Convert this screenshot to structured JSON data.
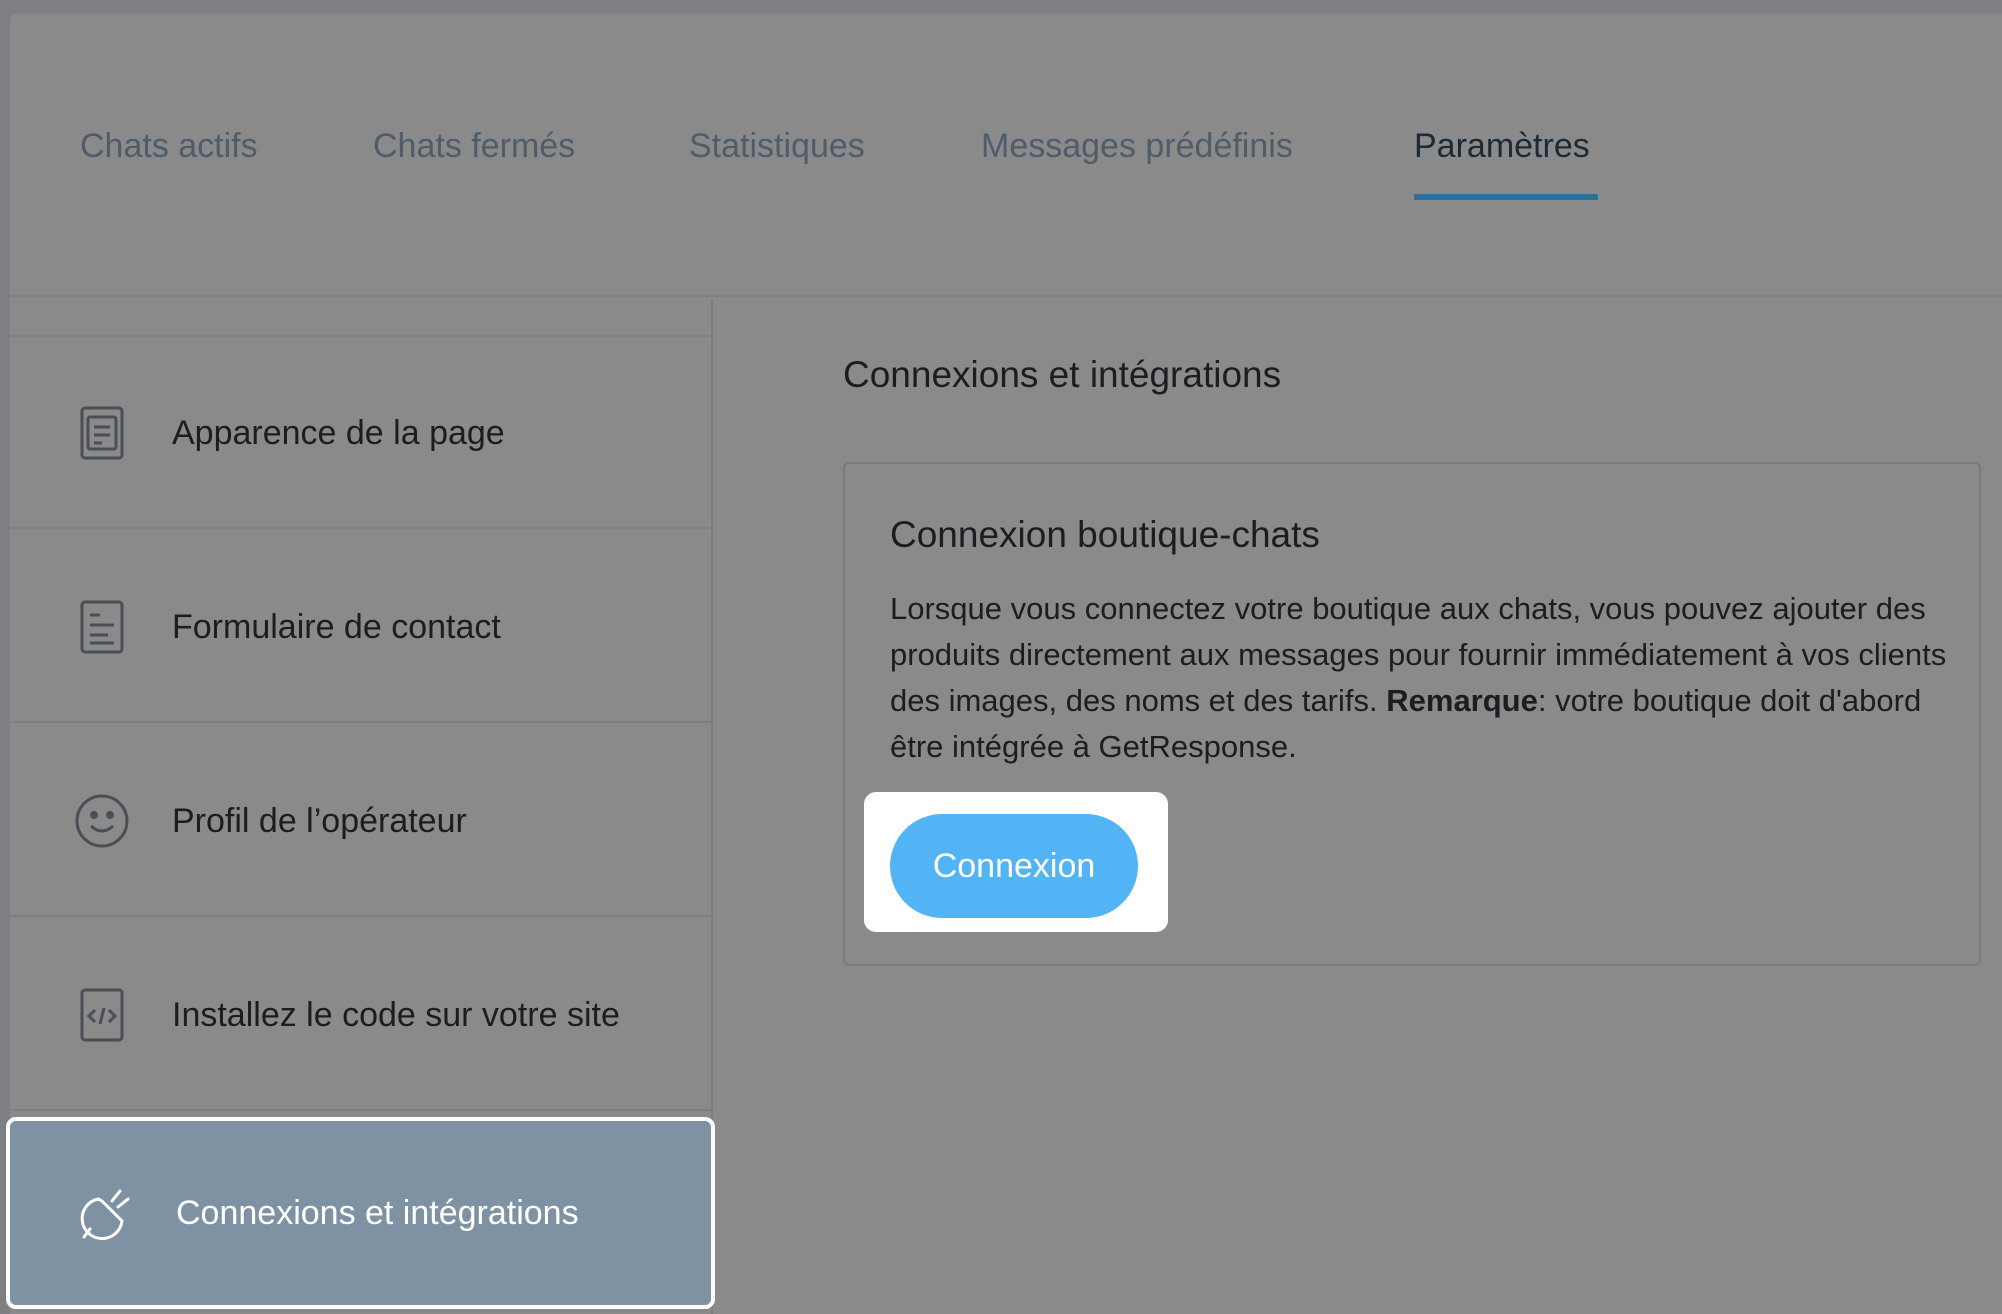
{
  "tabs": [
    {
      "label": "Chats actifs",
      "active": false
    },
    {
      "label": "Chats fermés",
      "active": false
    },
    {
      "label": "Statistiques",
      "active": false
    },
    {
      "label": "Messages prédéfinis",
      "active": false
    },
    {
      "label": "Paramètres",
      "active": true
    }
  ],
  "sidebar": {
    "items": [
      {
        "label": "Apparence de la page",
        "icon": "page-layout-icon"
      },
      {
        "label": "Formulaire de contact",
        "icon": "form-icon"
      },
      {
        "label": "Profil de l’opérateur",
        "icon": "smiley-icon"
      },
      {
        "label": "Installez le code sur votre site",
        "icon": "code-icon"
      },
      {
        "label": "Connexions et intégrations",
        "icon": "plug-icon",
        "active": true
      }
    ]
  },
  "main": {
    "title": "Connexions et intégrations",
    "card": {
      "title": "Connexion boutique-chats",
      "description": "Lorsque vous connectez votre boutique aux chats, vous pouvez ajouter des produits directement aux messages pour fournir immédiatement à vos clients des images, des noms et des tarifs.",
      "note_label": "Remarque",
      "note_text": ": votre boutique doit d'abord être intégrée à GetResponse.",
      "button_label": "Connexion"
    }
  },
  "colors": {
    "accent_blue": "#52b4f5",
    "tab_underline": "#2d6f9a",
    "active_sidebar_bg": "#7f92a3"
  }
}
